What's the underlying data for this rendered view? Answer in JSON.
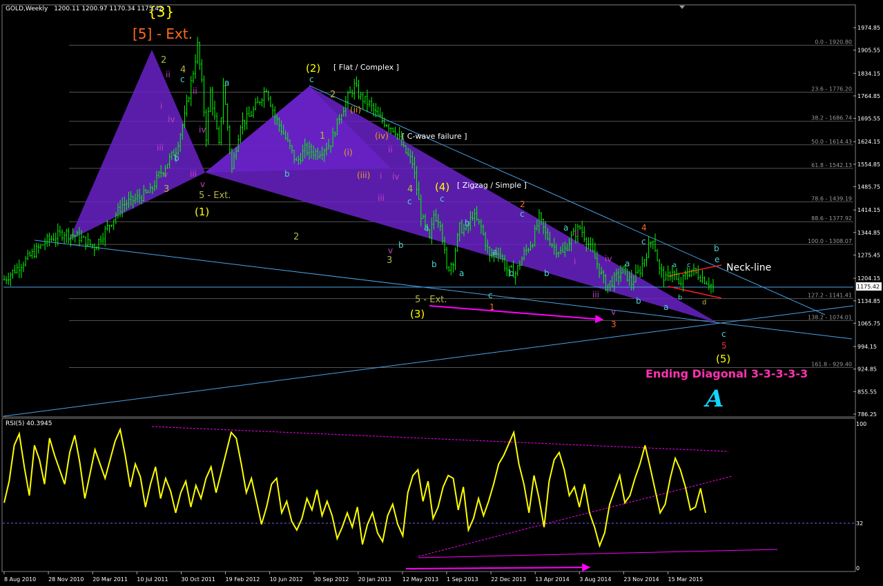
{
  "header": {
    "symbol": "GOLD,Weekly",
    "ohlc": "1200.11 1200.97 1170.34 1175.42",
    "rsi": "RSI(5) 40.3945"
  },
  "colors": {
    "background": "#000000",
    "candles": "#00ff00",
    "wedge": "#6a22c8",
    "trendline": "#4aa3e8",
    "fib": "#555555",
    "rsi": "#ffff00",
    "magenta": "#ff00ff",
    "label_yellow": "#ffff00",
    "label_orange": "#ff6a1f"
  },
  "chart_data": [
    {
      "type": "line",
      "subtype": "candlestick",
      "x_labels": [
        "8 Aug 2010",
        "28 Nov 2010",
        "20 Mar 2011",
        "10 Jul 2011",
        "30 Oct 2011",
        "19 Feb 2012",
        "10 Jun 2012",
        "30 Sep 2012",
        "20 Jan 2013",
        "12 May 2013",
        "1 Sep 2013",
        "22 Dec 2013",
        "13 Apr 2014",
        "3 Aug 2014",
        "23 Nov 2014",
        "15 Mar 2015"
      ],
      "y_ticks": [
        786.25,
        855.55,
        924.85,
        994.15,
        1065.75,
        1134.85,
        1204.15,
        1275.45,
        1344.85,
        1414.15,
        1485.75,
        1554.85,
        1624.15,
        1695.55,
        1764.85,
        1834.15,
        1905.55,
        1974.85
      ],
      "ylim": [
        786.25,
        2000
      ],
      "current_price": "1175.42",
      "price_path": [
        [
          0,
          1200
        ],
        [
          10,
          1260
        ],
        [
          20,
          1320
        ],
        [
          28,
          1345
        ],
        [
          35,
          1330
        ],
        [
          42,
          1300
        ],
        [
          48,
          1360
        ],
        [
          55,
          1430
        ],
        [
          62,
          1450
        ],
        [
          68,
          1470
        ],
        [
          72,
          1520
        ],
        [
          76,
          1560
        ],
        [
          80,
          1600
        ],
        [
          84,
          1700
        ],
        [
          88,
          1840
        ],
        [
          90,
          1920
        ],
        [
          92,
          1800
        ],
        [
          94,
          1640
        ],
        [
          96,
          1780
        ],
        [
          100,
          1610
        ],
        [
          102,
          1800
        ],
        [
          106,
          1540
        ],
        [
          110,
          1680
        ],
        [
          114,
          1700
        ],
        [
          118,
          1740
        ],
        [
          122,
          1790
        ],
        [
          126,
          1700
        ],
        [
          130,
          1650
        ],
        [
          136,
          1560
        ],
        [
          140,
          1600
        ],
        [
          146,
          1590
        ],
        [
          152,
          1620
        ],
        [
          156,
          1700
        ],
        [
          160,
          1760
        ],
        [
          163,
          1795
        ],
        [
          166,
          1760
        ],
        [
          170,
          1740
        ],
        [
          174,
          1700
        ],
        [
          178,
          1680
        ],
        [
          182,
          1660
        ],
        [
          186,
          1600
        ],
        [
          190,
          1560
        ],
        [
          194,
          1400
        ],
        [
          198,
          1320
        ],
        [
          200,
          1400
        ],
        [
          203,
          1380
        ],
        [
          206,
          1230
        ],
        [
          209,
          1260
        ],
        [
          212,
          1360
        ],
        [
          215,
          1350
        ],
        [
          218,
          1400
        ],
        [
          222,
          1360
        ],
        [
          226,
          1270
        ],
        [
          230,
          1290
        ],
        [
          234,
          1230
        ],
        [
          238,
          1220
        ],
        [
          242,
          1280
        ],
        [
          246,
          1320
        ],
        [
          249,
          1390
        ],
        [
          252,
          1340
        ],
        [
          256,
          1300
        ],
        [
          260,
          1280
        ],
        [
          264,
          1330
        ],
        [
          268,
          1360
        ],
        [
          272,
          1310
        ],
        [
          276,
          1250
        ],
        [
          280,
          1180
        ],
        [
          284,
          1200
        ],
        [
          288,
          1230
        ],
        [
          292,
          1190
        ],
        [
          296,
          1230
        ],
        [
          300,
          1300
        ],
        [
          302,
          1330
        ],
        [
          305,
          1230
        ],
        [
          308,
          1200
        ],
        [
          311,
          1230
        ],
        [
          314,
          1180
        ],
        [
          317,
          1210
        ],
        [
          320,
          1230
        ],
        [
          324,
          1210
        ],
        [
          328,
          1190
        ],
        [
          330,
          1175
        ]
      ],
      "fib_levels": [
        {
          "label": "0.0 - 1920.80",
          "value": 1920.8
        },
        {
          "label": "23.6 - 1776.20",
          "value": 1776.2
        },
        {
          "label": "38.2 - 1686.74",
          "value": 1686.74
        },
        {
          "label": "50.0 - 1614.43",
          "value": 1614.43
        },
        {
          "label": "61.8 - 1542.13",
          "value": 1542.13
        },
        {
          "label": "78.6 - 1439.19",
          "value": 1439.19
        },
        {
          "label": "88.6 - 1377.92",
          "value": 1377.92
        },
        {
          "label": "100.0 - 1308.07",
          "value": 1308.07
        },
        {
          "label": "127.2 - 1141.41",
          "value": 1141.41
        },
        {
          "label": "138.2 - 1074.01",
          "value": 1074.01
        },
        {
          "label": "161.8 - 929.40",
          "value": 929.4
        }
      ],
      "annotations": [
        "[5] - Ext.",
        "(1)",
        "(2)",
        "(3)",
        "(4)",
        "(5)",
        "5 - Ext.",
        "[ Flat / Complex ]",
        "[ C-wave failure ]",
        "[ Zigzag / Simple ]",
        "Neck-line",
        "Ending Diagonal 3-3-3-3-3"
      ]
    },
    {
      "type": "line",
      "title": "RSI(5) 40.3945",
      "y_ticks": [
        "100",
        "32",
        "0"
      ],
      "ylim": [
        0,
        100
      ],
      "values": [
        45,
        60,
        85,
        93,
        70,
        50,
        85,
        75,
        58,
        90,
        78,
        68,
        58,
        80,
        92,
        73,
        48,
        65,
        82,
        72,
        62,
        75,
        88,
        96,
        78,
        56,
        72,
        63,
        42,
        58,
        70,
        48,
        62,
        53,
        38,
        52,
        60,
        42,
        57,
        48,
        62,
        70,
        52,
        66,
        80,
        94,
        90,
        72,
        52,
        62,
        46,
        30,
        42,
        58,
        62,
        38,
        46,
        32,
        26,
        34,
        48,
        40,
        54,
        36,
        46,
        36,
        20,
        28,
        38,
        28,
        42,
        16,
        30,
        38,
        24,
        18,
        36,
        44,
        30,
        22,
        52,
        64,
        68,
        46,
        60,
        34,
        42,
        56,
        64,
        62,
        40,
        56,
        26,
        34,
        48,
        36,
        46,
        58,
        72,
        78,
        86,
        94,
        72,
        58,
        38,
        64,
        48,
        28,
        60,
        75,
        80,
        68,
        50,
        56,
        42,
        58,
        38,
        28,
        15,
        24,
        44,
        54,
        64,
        45,
        50,
        62,
        72,
        85,
        70,
        54,
        38,
        44,
        62,
        76,
        68,
        56,
        40,
        42,
        55,
        38
      ]
    }
  ],
  "wave_labels": {
    "l01": "{3}",
    "l02": "[5] - Ext.",
    "l03": "(2)",
    "l04": "[ Flat / Complex ]",
    "l05": "2",
    "l06": "4",
    "l07": "c",
    "l08": "ii",
    "l09": "ii",
    "l10": "a",
    "l11": "c",
    "l12": "2",
    "l13": "(ii)",
    "l14": "iv",
    "l15": "i",
    "l16": "iv",
    "l17": "1",
    "l18": "(iv)",
    "l19": "ii",
    "l20": "[ C-wave failure ]",
    "l21": "iii",
    "l22": "b",
    "l23": "iii",
    "l24": "v",
    "l25": "3",
    "l26": "v",
    "l27": "5 - Ext.",
    "l28": "(1)",
    "l29": "b",
    "l30": "(i)",
    "l31": "(iii)",
    "l32": "i",
    "l33": "iv",
    "l34": "4",
    "l35": "c",
    "l36": "(4)",
    "l37": "[ Zigzag / Simple ]",
    "l38": "iii",
    "l39": "v",
    "l40": "3",
    "l41": "b",
    "l42": "a",
    "l43": "b",
    "l44": "c",
    "l45": "a",
    "l46": "b",
    "l47": "2",
    "l48": "c",
    "l49": "a",
    "l50": "b",
    "l51": "b",
    "l52": "ii",
    "l53": "a",
    "l54": "i",
    "l55": "iv",
    "l56": "4",
    "l57": "c",
    "l58": "a",
    "l59": "b",
    "l60": "e",
    "l61": "Neck-line",
    "l62": "a",
    "l63": "c",
    "l64": "b",
    "l65": "d",
    "l66": "iii",
    "l67": "b",
    "l68": "a",
    "l69": "v",
    "l70": "3",
    "l71": "c",
    "l72": "1",
    "l73": "5 - Ext.",
    "l74": "(3)",
    "l75": "c",
    "l76": "5",
    "l77": "(5)",
    "l78": "Ending Diagonal 3-3-3-3-3",
    "l79": "2",
    "l80": "A"
  }
}
